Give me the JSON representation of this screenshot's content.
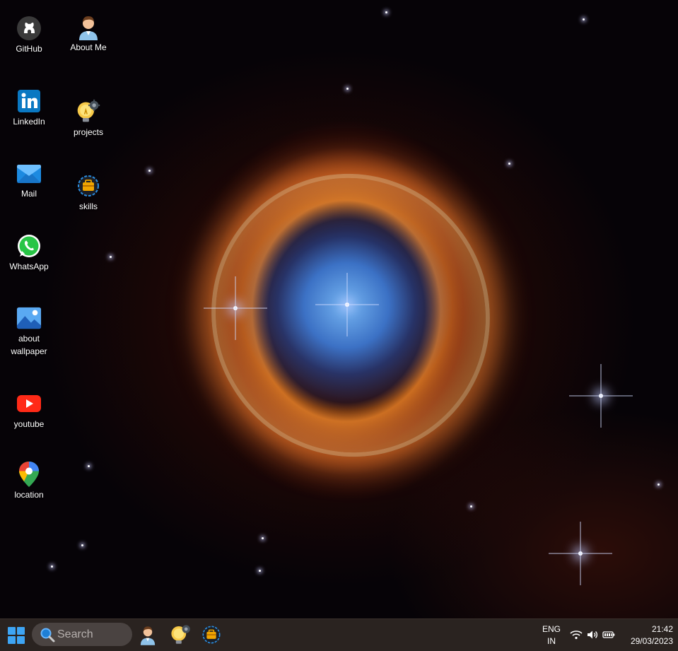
{
  "desktop": {
    "icons": [
      {
        "label": "GitHub",
        "icon": "github-icon"
      },
      {
        "label": "About Me",
        "icon": "user-icon"
      },
      {
        "label": "LinkedIn",
        "icon": "linkedin-icon"
      },
      {
        "label": "projects",
        "icon": "lightbulb-gear-icon"
      },
      {
        "label": "Mail",
        "icon": "mail-icon"
      },
      {
        "label": "skills",
        "icon": "toolbox-gear-icon"
      },
      {
        "label": "WhatsApp",
        "icon": "whatsapp-icon"
      },
      {
        "label": "about wallpaper",
        "icon": "image-icon"
      },
      {
        "label": "youtube",
        "icon": "youtube-icon"
      },
      {
        "label": "location",
        "icon": "map-pin-icon"
      }
    ]
  },
  "taskbar": {
    "search_placeholder": "Search",
    "language_line1": "ENG",
    "language_line2": "IN",
    "time": "21:42",
    "date": "29/03/2023",
    "pinned_apps": [
      "user-icon",
      "lightbulb-gear-icon",
      "toolbox-gear-icon"
    ]
  },
  "colors": {
    "taskbar_bg": "#2a2320",
    "search_bg": "#4a4341",
    "accent": "#0a78d4"
  }
}
